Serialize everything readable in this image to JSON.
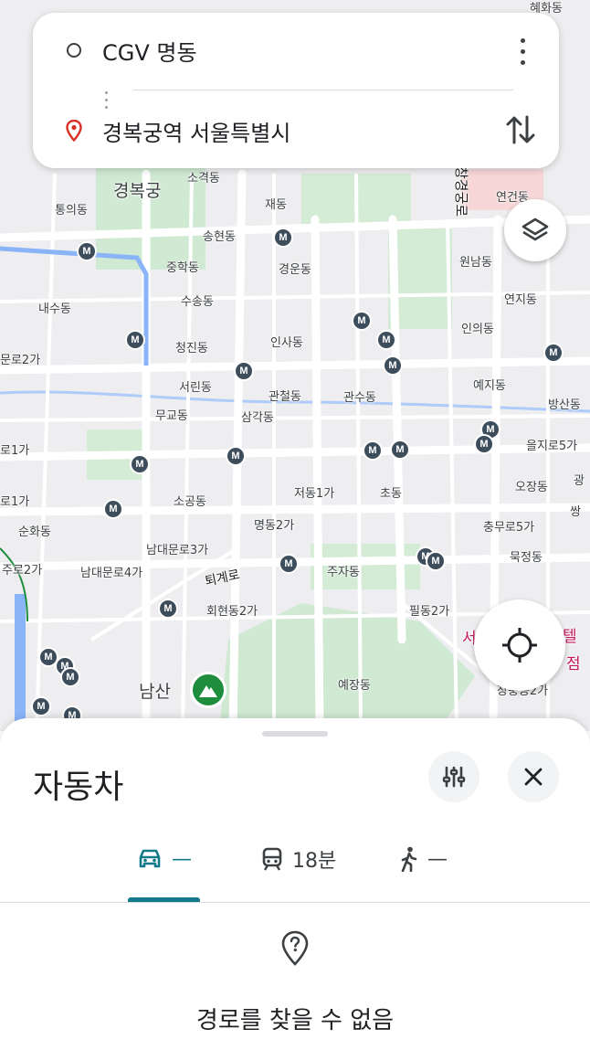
{
  "search": {
    "origin": "CGV 명동",
    "destination": "경복궁역 서울특별시"
  },
  "map": {
    "labels": {
      "gyeongbokgung": "경복궁",
      "sogyeok": "소격동",
      "jae": "재동",
      "tongui": "통의동",
      "songhyeon": "송현동",
      "junghak": "중학동",
      "gyeongun": "경운동",
      "susong": "수송동",
      "naesu": "내수동",
      "cheongjin": "청진동",
      "insa": "인사동",
      "yeongeon": "연건동",
      "wonnam": "원남동",
      "yeonji": "연지동",
      "inui": "인의동",
      "yeji": "예지동",
      "seorin": "서린동",
      "gwancheol": "관철동",
      "gwansu": "관수동",
      "mugyo": "무교동",
      "samgak": "삼각동",
      "bangsan": "방산동",
      "euljiro5": "을지로5가",
      "ojang": "오장동",
      "sogong": "소공동",
      "jeodong1": "저동1가",
      "cho": "초동",
      "myeongdong2": "명동2가",
      "chungmuro5": "충무로5가",
      "namdaemunro3": "남대문로3가",
      "namdaemunro4": "남대문로4가",
      "toegyero": "퇴계로",
      "juja": "주자동",
      "mukjeong": "묵정동",
      "hoehyeon2": "회현동2가",
      "pildong2": "필동2가",
      "namsan": "남산",
      "yejang": "예장동",
      "suncheon": "순화동",
      "juro2": "주로2가",
      "munro2": "문로2가",
      "ro1a": "로1가",
      "ro1b": "로1가",
      "hyehwa": "혜화동",
      "changgyeonggung": "창경궁로",
      "gwang": "광",
      "ssang": "쌍",
      "jangchung2": "장충동2가",
      "hotel_a": "서",
      "hotel_b": "텔",
      "hotel_c": "점"
    },
    "metro_letter": "M"
  },
  "sheet": {
    "title": "자동차",
    "modes": [
      {
        "icon": "car-icon",
        "label": "—",
        "active": true
      },
      {
        "icon": "train-icon",
        "label": "18분",
        "active": false
      },
      {
        "icon": "walk-icon",
        "label": "—",
        "active": false
      }
    ],
    "message": "경로를 찾을 수 없음"
  },
  "colors": {
    "accent": "#137a8a",
    "destination_pin": "#d93025",
    "park": "#1e8e3e",
    "metro": "#3d4d5c",
    "map_bg": "#eeeef0"
  }
}
